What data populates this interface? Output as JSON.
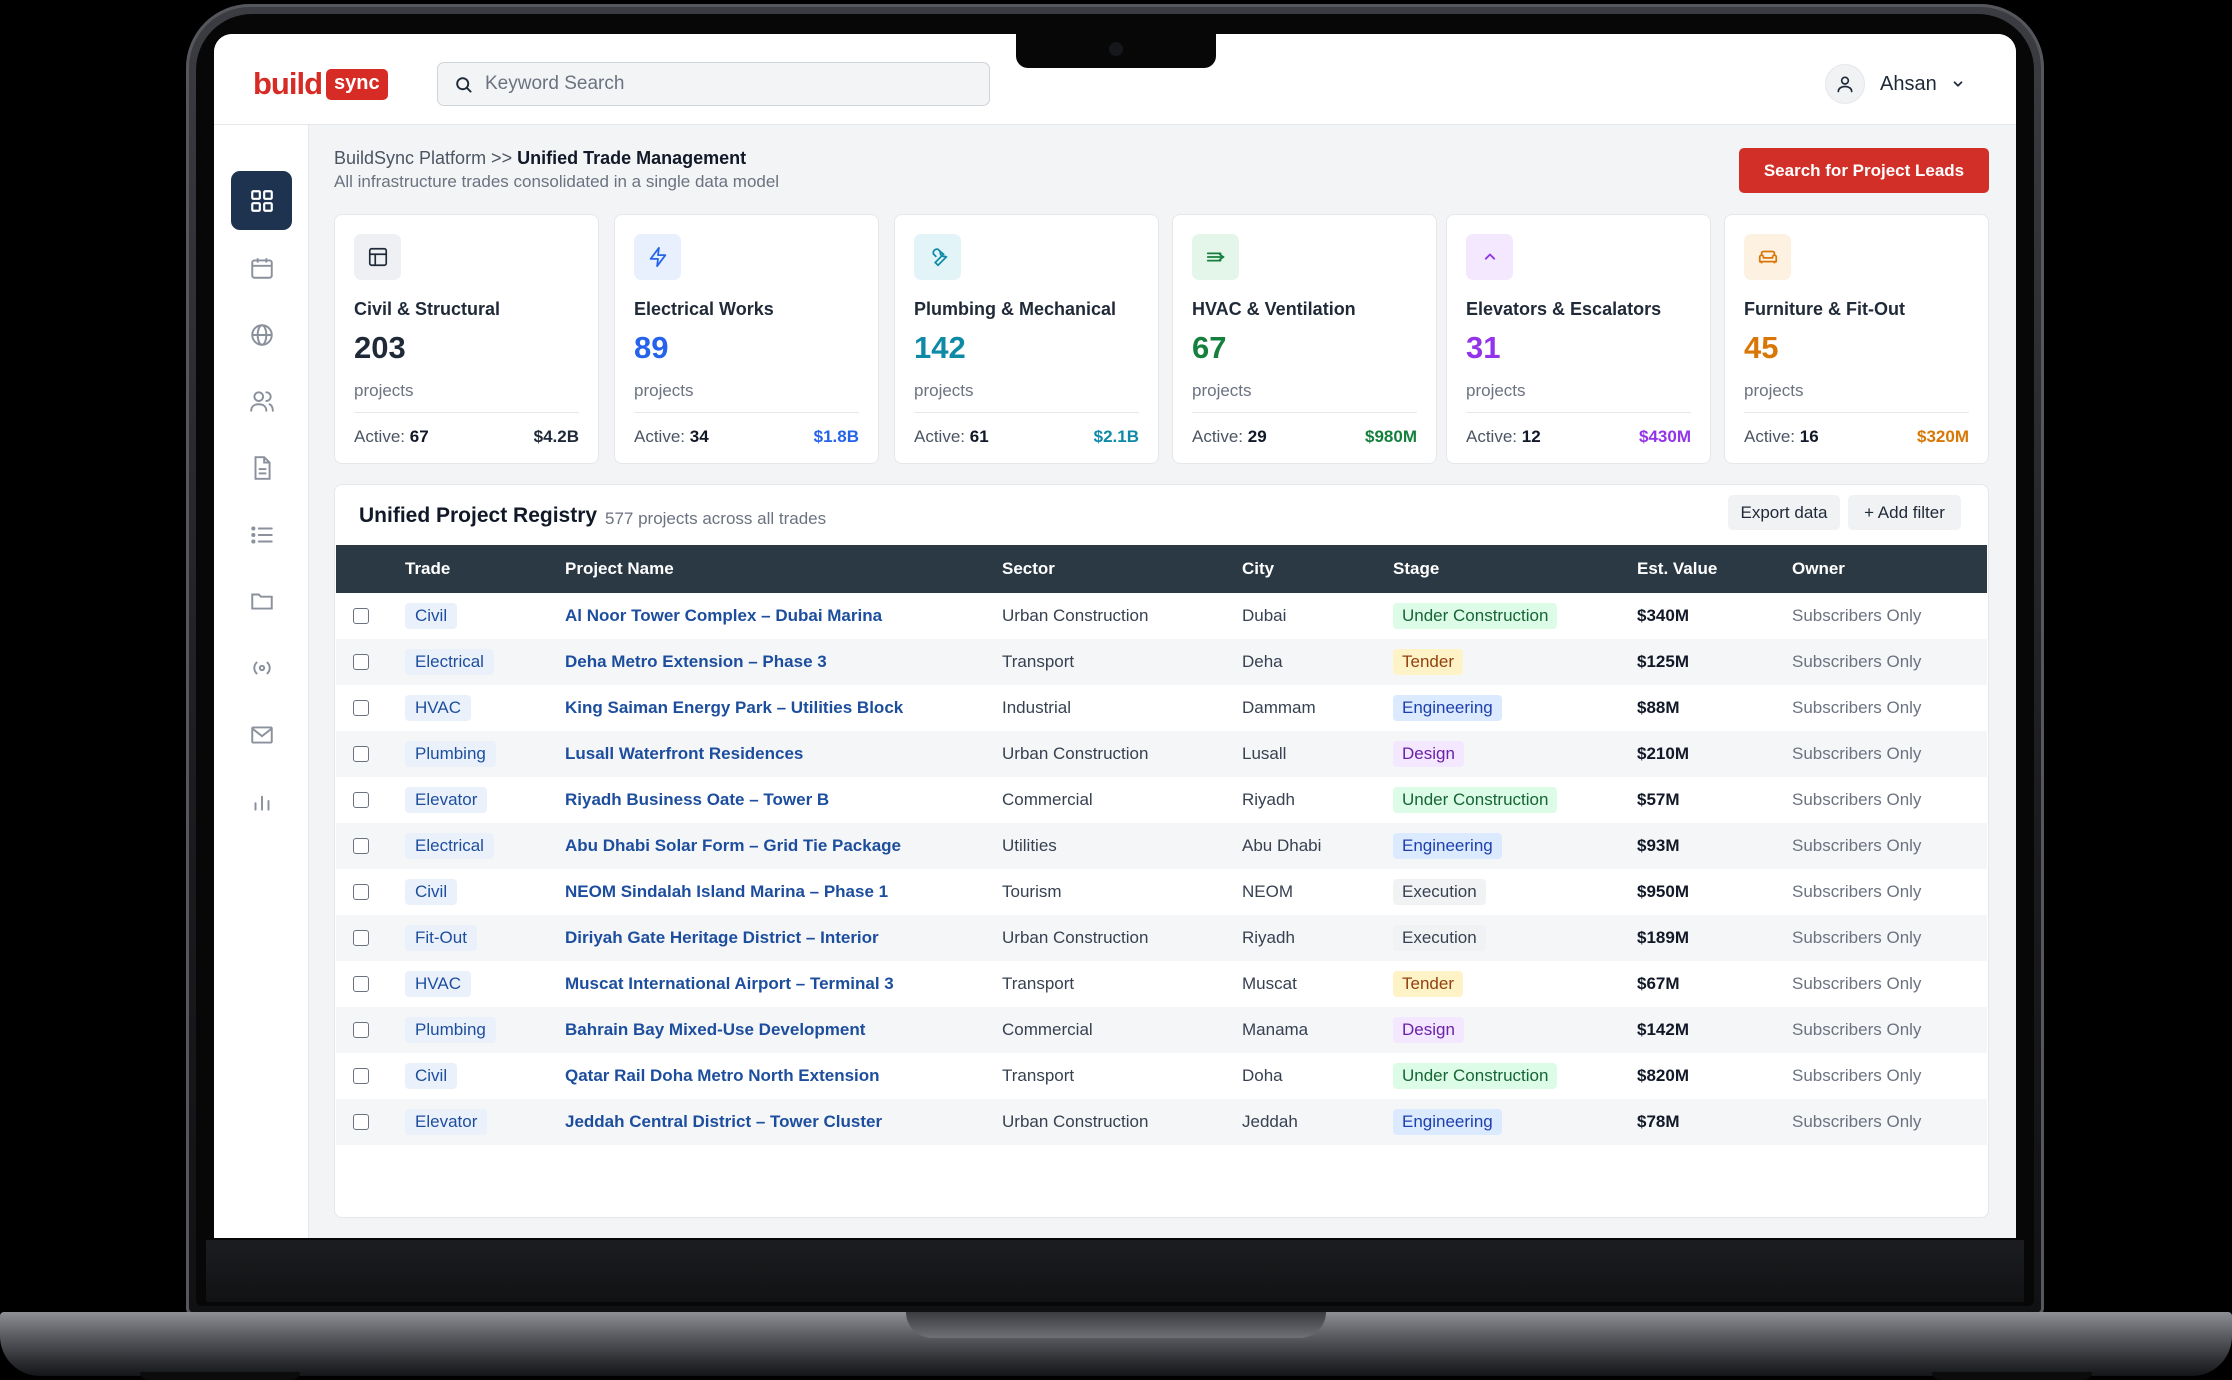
{
  "brand": {
    "part1": "build",
    "part2": "sync"
  },
  "search": {
    "placeholder": "Keyword Search"
  },
  "user": {
    "name": "Ahsan"
  },
  "sidebar": {
    "items": [
      {
        "icon": "grid-icon",
        "active": true
      },
      {
        "icon": "calendar-icon",
        "active": false
      },
      {
        "icon": "globe-icon",
        "active": false
      },
      {
        "icon": "users-icon",
        "active": false
      },
      {
        "icon": "document-icon",
        "active": false
      },
      {
        "icon": "list-icon",
        "active": false
      },
      {
        "icon": "folder-icon",
        "active": false
      },
      {
        "icon": "broadcast-icon",
        "active": false
      },
      {
        "icon": "mail-icon",
        "active": false
      },
      {
        "icon": "bar-chart-icon",
        "active": false
      }
    ]
  },
  "header": {
    "breadcrumb_root": "BuildSync Platform >> ",
    "breadcrumb_current": "Unified Trade Management",
    "subtitle": "All infrastructure trades consolidated in a single data model",
    "cta_label": "Search for Project Leads"
  },
  "cards": [
    {
      "title": "Civil & Structural",
      "count": "203",
      "unit": "projects",
      "active_label": "Active: ",
      "active": "67",
      "value": "$4.2B",
      "color": "#1f2937",
      "icon": "building-icon"
    },
    {
      "title": "Electrical Works",
      "count": "89",
      "unit": "projects",
      "active_label": "Active: ",
      "active": "34",
      "value": "$1.8B",
      "color": "#2563eb",
      "icon": "lightning-icon"
    },
    {
      "title": "Plumbing & Mechanical",
      "count": "142",
      "unit": "projects",
      "active_label": "Active: ",
      "active": "61",
      "value": "$2.1B",
      "color": "#0e8aa6",
      "icon": "wrench-icon"
    },
    {
      "title": "HVAC & Ventilation",
      "count": "67",
      "unit": "projects",
      "active_label": "Active: ",
      "active": "29",
      "value": "$980M",
      "color": "#15803d",
      "icon": "airflow-icon"
    },
    {
      "title": "Elevators & Escalators",
      "count": "31",
      "unit": "projects",
      "active_label": "Active: ",
      "active": "12",
      "value": "$430M",
      "color": "#9333ea",
      "icon": "chevron-up-icon"
    },
    {
      "title": "Furniture & Fit-Out",
      "count": "45",
      "unit": "projects",
      "active_label": "Active: ",
      "active": "16",
      "value": "$320M",
      "color": "#d97706",
      "icon": "sofa-icon"
    }
  ],
  "registry": {
    "title": "Unified Project Registry",
    "count": "577 projects across all trades",
    "export_label": "Export data",
    "filter_label": "+ Add filter",
    "columns": [
      "Trade",
      "Project Name",
      "Sector",
      "City",
      "Stage",
      "Est. Value",
      "Owner"
    ],
    "rows": [
      {
        "trade": "Civil",
        "name": "Al Noor Tower Complex – Dubai Marina",
        "sector": "Urban Construction",
        "city": "Dubai",
        "stage": "Under Construction",
        "stage_type": "uc",
        "value": "$340M",
        "owner": "Subscribers Only"
      },
      {
        "trade": "Electrical",
        "name": "Deha Metro Extension – Phase 3",
        "sector": "Transport",
        "city": "Deha",
        "stage": "Tender",
        "stage_type": "tender",
        "value": "$125M",
        "owner": "Subscribers Only"
      },
      {
        "trade": "HVAC",
        "name": "King Saiman Energy Park – Utilities Block",
        "sector": "Industrial",
        "city": "Dammam",
        "stage": "Engineering",
        "stage_type": "eng",
        "value": "$88M",
        "owner": "Subscribers Only"
      },
      {
        "trade": "Plumbing",
        "name": "Lusall Waterfront Residences",
        "sector": "Urban Construction",
        "city": "Lusall",
        "stage": "Design",
        "stage_type": "design",
        "value": "$210M",
        "owner": "Subscribers Only"
      },
      {
        "trade": "Elevator",
        "name": "Riyadh Business Oate – Tower B",
        "sector": "Commercial",
        "city": "Riyadh",
        "stage": "Under Construction",
        "stage_type": "uc",
        "value": "$57M",
        "owner": "Subscribers Only"
      },
      {
        "trade": "Electrical",
        "name": "Abu Dhabi Solar Form – Grid Tie Package",
        "sector": "Utilities",
        "city": "Abu Dhabi",
        "stage": "Engineering",
        "stage_type": "eng",
        "value": "$93M",
        "owner": "Subscribers Only"
      },
      {
        "trade": "Civil",
        "name": "NEOM Sindalah Island Marina – Phase 1",
        "sector": "Tourism",
        "city": "NEOM",
        "stage": "Execution",
        "stage_type": "exec",
        "value": "$950M",
        "owner": "Subscribers Only"
      },
      {
        "trade": "Fit-Out",
        "name": "Diriyah Gate Heritage District – Interior",
        "sector": "Urban Construction",
        "city": "Riyadh",
        "stage": "Execution",
        "stage_type": "exec",
        "value": "$189M",
        "owner": "Subscribers Only"
      },
      {
        "trade": "HVAC",
        "name": "Muscat International Airport – Terminal 3",
        "sector": "Transport",
        "city": "Muscat",
        "stage": "Tender",
        "stage_type": "tender",
        "value": "$67M",
        "owner": "Subscribers Only"
      },
      {
        "trade": "Plumbing",
        "name": "Bahrain Bay Mixed-Use Development",
        "sector": "Commercial",
        "city": "Manama",
        "stage": "Design",
        "stage_type": "design",
        "value": "$142M",
        "owner": "Subscribers Only"
      },
      {
        "trade": "Civil",
        "name": "Qatar Rail Doha Metro North Extension",
        "sector": "Transport",
        "city": "Doha",
        "stage": "Under Construction",
        "stage_type": "uc",
        "value": "$820M",
        "owner": "Subscribers Only"
      },
      {
        "trade": "Elevator",
        "name": "Jeddah Central District – Tower Cluster",
        "sector": "Urban Construction",
        "city": "Jeddah",
        "stage": "Engineering",
        "stage_type": "eng",
        "value": "$78M",
        "owner": "Subscribers Only"
      }
    ]
  }
}
